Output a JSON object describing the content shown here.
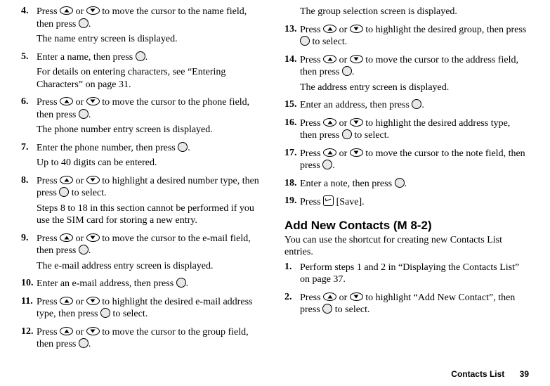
{
  "left": {
    "steps": [
      {
        "n": "4.",
        "lines": [
          "Press {up} or {down} to move the cursor to the name field, then press {ok}.",
          "The name entry screen is displayed."
        ]
      },
      {
        "n": "5.",
        "lines": [
          "Enter a name, then press {ok}.",
          "For details on entering characters, see “Entering Characters” on page 31."
        ]
      },
      {
        "n": "6.",
        "lines": [
          "Press {up} or {down} to move the cursor to the phone field, then press {ok}.",
          "The phone number entry screen is displayed."
        ]
      },
      {
        "n": "7.",
        "lines": [
          "Enter the phone number, then press {ok}.",
          "Up to 40 digits can be entered."
        ]
      },
      {
        "n": "8.",
        "lines": [
          "Press {up} or {down} to highlight a desired number type, then press {ok} to select.",
          "Steps 8 to 18 in this section cannot be performed if you use the SIM card for storing a new entry."
        ]
      },
      {
        "n": "9.",
        "lines": [
          "Press {up} or {down} to move the cursor to the e-mail field, then press {ok}.",
          "The e-mail address entry screen is displayed."
        ]
      },
      {
        "n": "10.",
        "lines": [
          "Enter an e-mail address, then press {ok}."
        ]
      },
      {
        "n": "11.",
        "lines": [
          "Press {up} or {down} to highlight the desired e-mail address type, then press {ok} to select."
        ]
      },
      {
        "n": "12.",
        "lines": [
          "Press {up} or {down} to move the cursor to the group field, then press {ok}."
        ]
      }
    ]
  },
  "right": {
    "continuation": "The group selection screen is displayed.",
    "steps": [
      {
        "n": "13.",
        "lines": [
          "Press {up} or {down} to highlight the desired group, then press {ok} to select."
        ]
      },
      {
        "n": "14.",
        "lines": [
          "Press {up} or {down} to move the cursor to the address field, then press {ok}.",
          "The address entry screen is displayed."
        ]
      },
      {
        "n": "15.",
        "lines": [
          "Enter an address, then press {ok}."
        ]
      },
      {
        "n": "16.",
        "lines": [
          "Press {up} or {down} to highlight the desired address type, then press {ok} to select."
        ]
      },
      {
        "n": "17.",
        "lines": [
          "Press {up} or {down} to move the cursor to the note field, then press {ok}."
        ]
      },
      {
        "n": "18.",
        "lines": [
          "Enter a note, then press {ok}."
        ]
      },
      {
        "n": "19.",
        "lines": [
          "Press {soft} [Save]."
        ]
      }
    ],
    "heading": "Add New Contacts (M 8-2)",
    "intro": "You can use the shortcut for creating new Contacts List entries.",
    "steps2": [
      {
        "n": "1.",
        "lines": [
          "Perform steps 1 and 2 in “Displaying the Contacts List” on page 37."
        ]
      },
      {
        "n": "2.",
        "lines": [
          "Press {up} or {down} to highlight “Add New Contact”, then press {ok} to select."
        ]
      }
    ]
  },
  "folio": {
    "title": "Contacts List",
    "page": "39"
  }
}
